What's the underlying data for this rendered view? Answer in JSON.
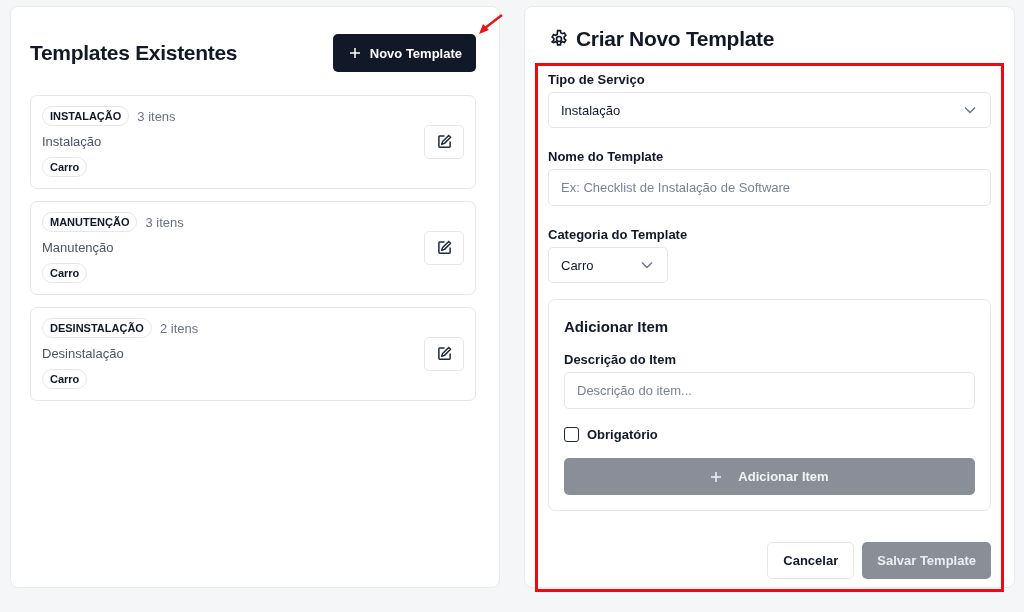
{
  "templates_panel": {
    "title": "Templates Existentes",
    "new_button": "Novo Template",
    "templates": [
      {
        "service": "INSTALAÇÃO",
        "count": "3 itens",
        "name": "Instalação",
        "category": "Carro"
      },
      {
        "service": "MANUTENÇÃO",
        "count": "3 itens",
        "name": "Manutenção",
        "category": "Carro"
      },
      {
        "service": "DESINSTALAÇÃO",
        "count": "2 itens",
        "name": "Desinstalação",
        "category": "Carro"
      }
    ]
  },
  "form_panel": {
    "title": "Criar Novo Template",
    "service_type": {
      "label": "Tipo de Serviço",
      "value": "Instalação"
    },
    "template_name": {
      "label": "Nome do Template",
      "placeholder": "Ex: Checklist de Instalação de Software"
    },
    "category": {
      "label": "Categoria do Template",
      "value": "Carro"
    },
    "add_item": {
      "title": "Adicionar Item",
      "description_label": "Descrição do Item",
      "description_placeholder": "Descrição do item...",
      "required_label": "Obrigatório",
      "required_checked": false,
      "button": "Adicionar Item",
      "button_disabled": true
    },
    "cancel_button": "Cancelar",
    "save_button": {
      "label": "Salvar Template",
      "disabled": true
    }
  }
}
